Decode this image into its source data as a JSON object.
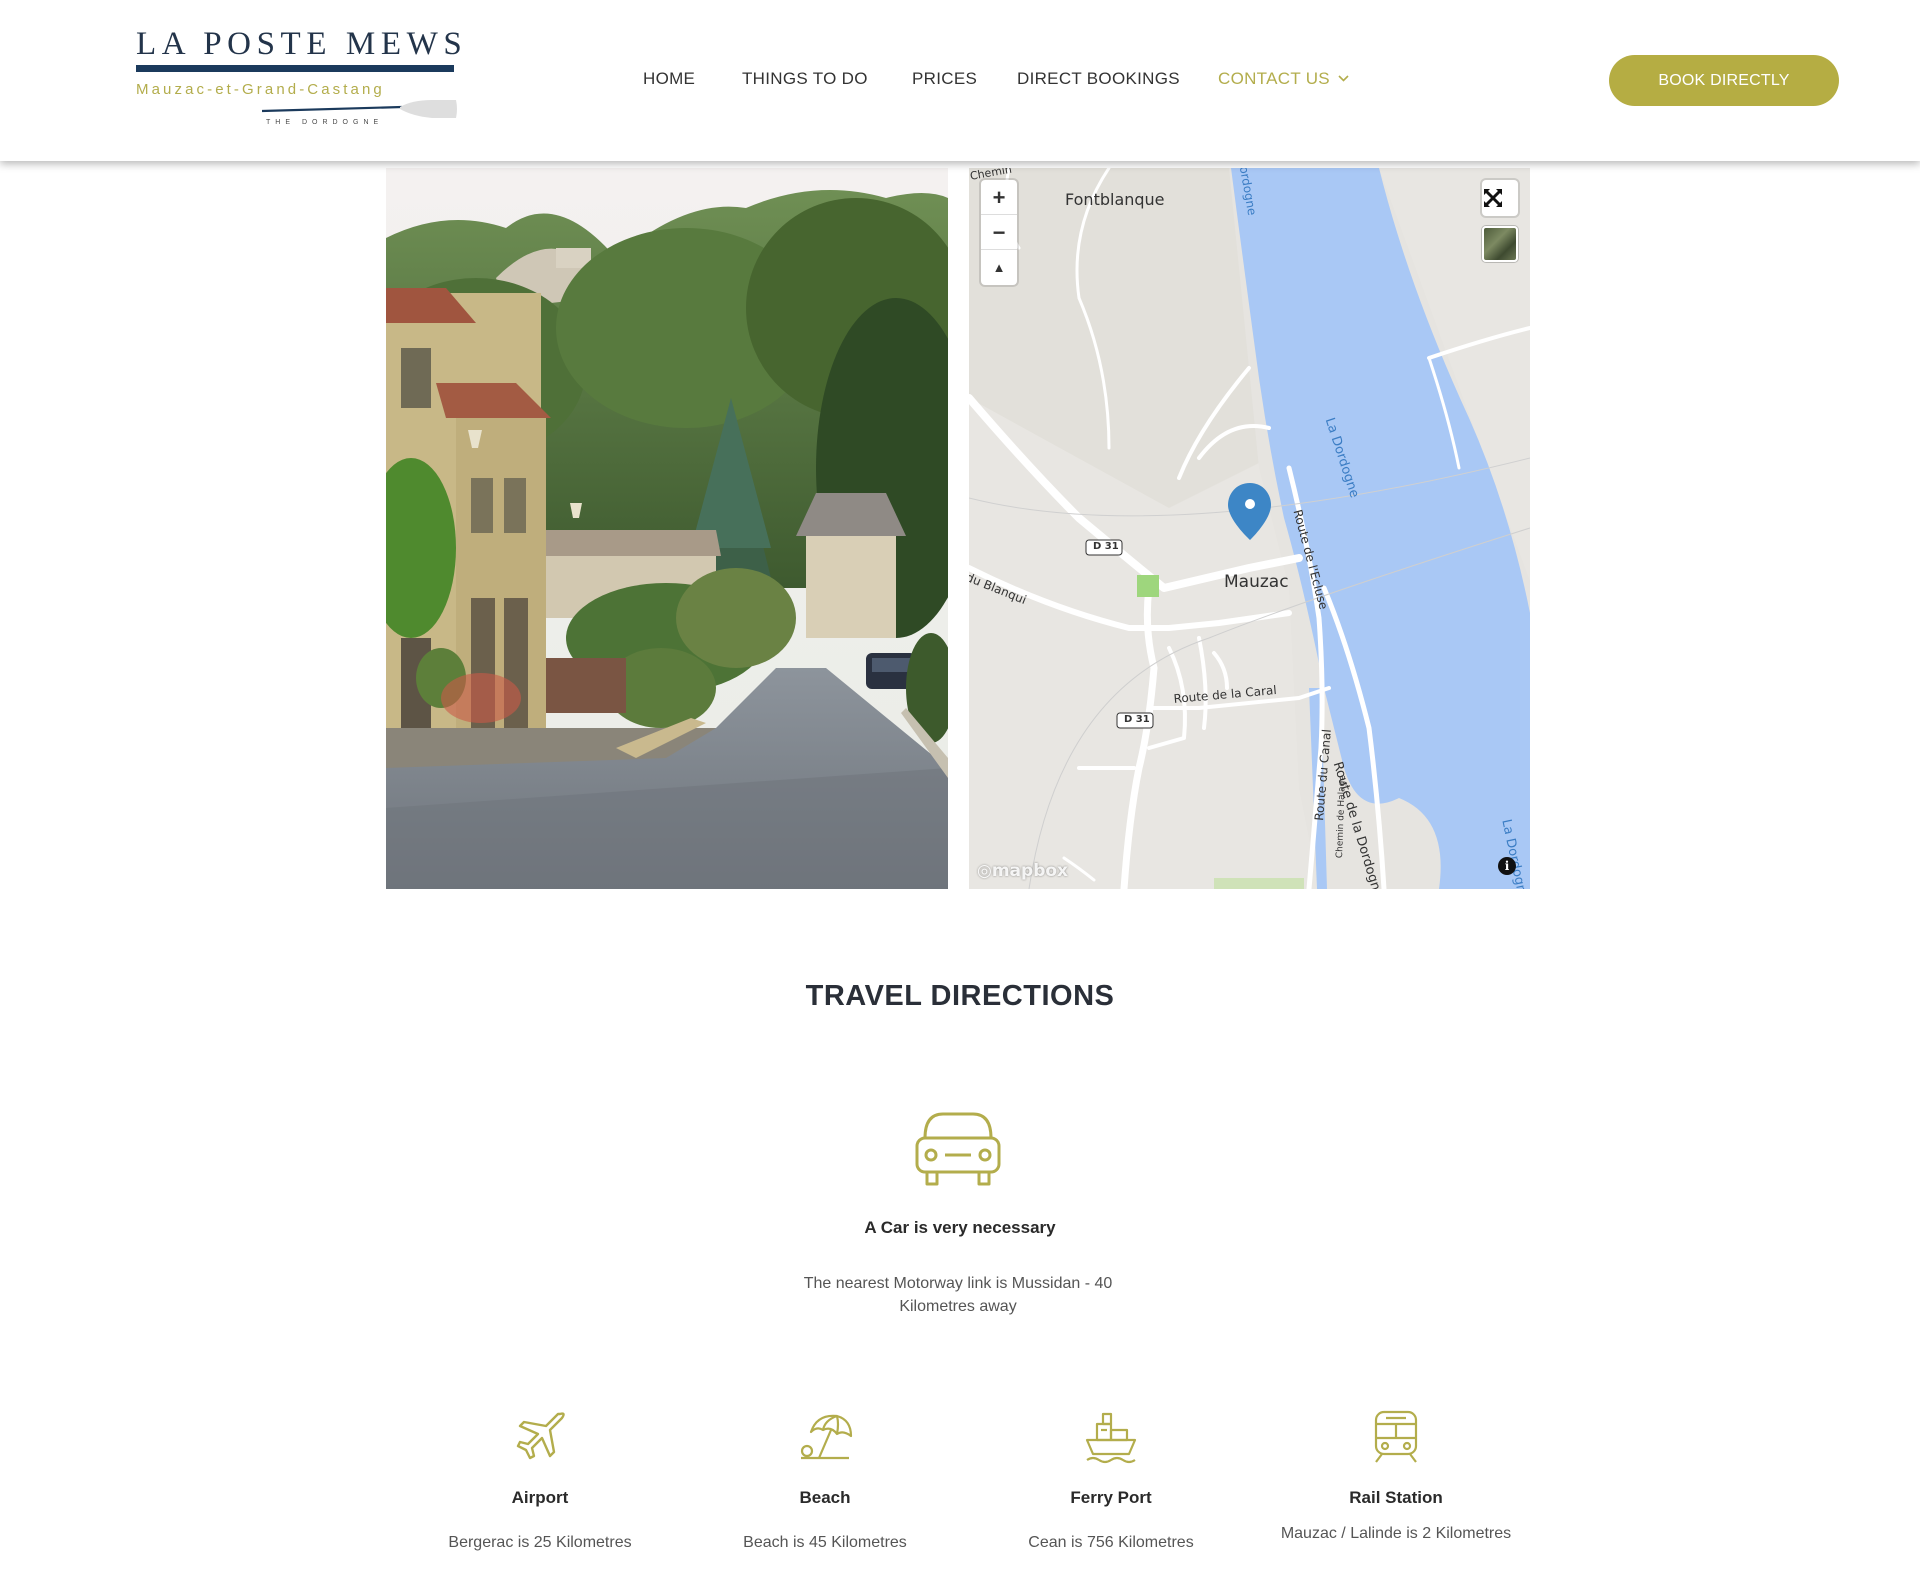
{
  "brand": {
    "title": "LA POSTE MEWS",
    "subtitle": "Mauzac-et-Grand-Castang",
    "tagline": "THE DORDOGNE"
  },
  "nav": {
    "items": [
      {
        "label": "HOME"
      },
      {
        "label": "THINGS TO DO"
      },
      {
        "label": "PRICES"
      },
      {
        "label": "DIRECT BOOKINGS"
      },
      {
        "label": "CONTACT US",
        "active": true,
        "has_dropdown": true
      }
    ],
    "cta_label": "BOOK DIRECTLY"
  },
  "map": {
    "labels": {
      "fontblanque": "Fontblanque",
      "mauzac": "Mauzac",
      "river": "La Dordogne",
      "river_south": "La Dordogne",
      "river_top": "Dordogne",
      "road_d31_a": "D 31",
      "road_d31_b": "D 31",
      "route_ecluse": "Route de l'Ecluse",
      "route_caral": "Route de la Caral",
      "route_canal": "Route du Canal",
      "route_dordogne": "Route de la Dordogne",
      "chemin_halage": "Chemin de Halage",
      "du_blanqui": "du Blanqui",
      "chemin_top": "Chemin"
    },
    "controls": {
      "zoom_in": "+",
      "zoom_out": "−",
      "compass": "▲"
    },
    "attribution": "mapbox",
    "info": "i"
  },
  "directions": {
    "title": "TRAVEL DIRECTIONS",
    "car": {
      "icon": "car-icon",
      "title": "A Car is very necessary",
      "text": "The nearest Motorway link is Mussidan - 40 Kilometres away"
    },
    "features": [
      {
        "icon": "airplane-icon",
        "title": "Airport",
        "text": "Bergerac is 25 Kilometres"
      },
      {
        "icon": "beach-umbrella-icon",
        "title": "Beach",
        "text": "Beach is 45 Kilometres"
      },
      {
        "icon": "ferry-icon",
        "title": "Ferry Port",
        "text": "Cean is 756 Kilometres"
      },
      {
        "icon": "train-icon",
        "title": "Rail Station",
        "text": "Mauzac / Lalinde is 2 Kilometres"
      }
    ]
  },
  "colors": {
    "accent": "#b5ad43",
    "navy": "#1b3a5c",
    "river": "#a9c8f5"
  }
}
